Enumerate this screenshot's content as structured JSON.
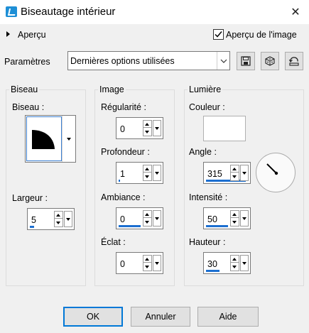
{
  "window": {
    "title": "Biseautage intérieur",
    "close_glyph": "✕"
  },
  "preview": {
    "toggle_label": "Aperçu",
    "checkbox_label": "Aperçu de l'image",
    "checked": true
  },
  "presets": {
    "label": "Paramètres",
    "selected": "Dernières options utilisées"
  },
  "toolbar_icons": {
    "save": "save-icon",
    "random": "dice-icon",
    "reset": "reset-icon"
  },
  "biseau": {
    "group_title": "Biseau",
    "shape_label": "Biseau :",
    "width_label": "Largeur :",
    "width_value": "5"
  },
  "image": {
    "group_title": "Image",
    "smoothness_label": "Régularité :",
    "smoothness_value": "0",
    "depth_label": "Profondeur :",
    "depth_value": "1",
    "ambience_label": "Ambiance :",
    "ambience_value": "0",
    "shininess_label": "Éclat :",
    "shininess_value": "0"
  },
  "light": {
    "group_title": "Lumière",
    "color_label": "Couleur :",
    "color_value": "#ffffff",
    "angle_label": "Angle :",
    "angle_value": "315",
    "intensity_label": "Intensité :",
    "intensity_value": "50",
    "elevation_label": "Hauteur :",
    "elevation_value": "30"
  },
  "buttons": {
    "ok": "OK",
    "cancel": "Annuler",
    "help": "Aide"
  },
  "colors": {
    "accent": "#1c6fd0",
    "focus": "#0078d7",
    "background": "#f0f0f0"
  }
}
